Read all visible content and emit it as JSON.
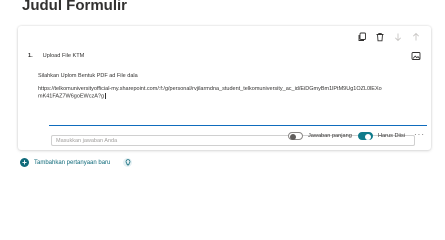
{
  "form": {
    "title": "Judul Formulir"
  },
  "question": {
    "number": "1.",
    "title": "Upload File KTM",
    "description_line1": "Silahkan Uplom Bentuk PDF ad File dala",
    "description_line2": "https://telkomuniversityofficial-my.sharepoint.com/:f:/g/personal/rvjilarmdna_student_telkomuniversity_ac_id/EiDGmyBm1lPtM9Ug1OZL0lEXomK41FAZ7W6goEWczA?g",
    "answer_placeholder": "Masukkan jawaban Anda"
  },
  "toolbar": {
    "copy_icon": "copy-icon",
    "delete_icon": "delete-icon",
    "move_down_icon": "arrow-down-icon",
    "move_up_icon": "arrow-up-icon"
  },
  "options": {
    "long_answer_label": "Jawaban panjang",
    "long_answer_on": false,
    "required_label": "Harus Diisi",
    "required_on": true,
    "more_label": "···"
  },
  "footer": {
    "add_question_label": "Tambahkan pertanyaan baru"
  },
  "colors": {
    "accent": "#0f6a7a",
    "toggle_on": "#0f7b8b",
    "focus_line": "#0f6cbd"
  }
}
